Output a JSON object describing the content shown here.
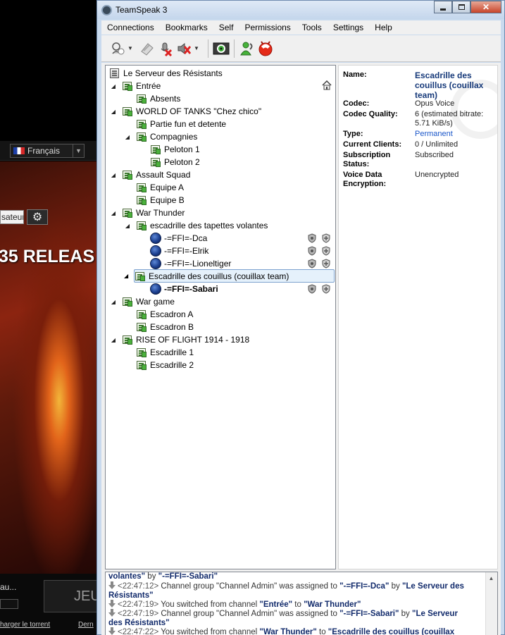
{
  "background_app": {
    "language": "Français",
    "user_button_label": "sateur",
    "banner_text": "35 RELEAS",
    "login_label": "au...",
    "play_button_label": "JEU",
    "download_link": "harger le torrent",
    "last_link": "Dern"
  },
  "window": {
    "title": "TeamSpeak 3"
  },
  "menu": [
    "Connections",
    "Bookmarks",
    "Self",
    "Permissions",
    "Tools",
    "Settings",
    "Help"
  ],
  "toolbar": {
    "icons": [
      "connect-icon",
      "disconnect-icon",
      "mute-microphone-icon",
      "mute-speakers-icon",
      "away-icon",
      "subscribe-icon",
      "identity-icon"
    ]
  },
  "tree": {
    "server": "Le Serveur des Résistants",
    "channels": [
      "Entrée",
      "Absents",
      "WORLD OF TANKS \"Chez chico\"",
      "Partie fun et detente",
      "Compagnies",
      "Peloton 1",
      "Peloton 2",
      "Assault Squad",
      "Equipe A",
      "Equipe B",
      "War Thunder",
      "escadrille des tapettes volantes",
      "Escadrille des couillus (couillax team)",
      "War game",
      "Escadron A",
      "Escadron B",
      "RISE OF FLIGHT 1914 - 1918",
      "Escadrille 1",
      "Escadrille 2"
    ],
    "clients": [
      "-=FFI=-Dca",
      "-=FFI=-Elrik",
      "-=FFI=-Lioneltiger",
      "-=FFI=-Sabari"
    ]
  },
  "info": {
    "name_label": "Name:",
    "name_value": "Escadrille des couillus (couillax team)",
    "codec_label": "Codec:",
    "codec_value": "Opus Voice",
    "quality_label": "Codec Quality:",
    "quality_value": "6 (estimated bitrate: 5.71 KiB/s)",
    "type_label": "Type:",
    "type_value": "Permanent",
    "clients_label": "Current Clients:",
    "clients_value": "0 / Unlimited",
    "subscription_label": "Subscription Status:",
    "subscription_value": "Subscribed",
    "encryption_label": "Voice Data Encryption:",
    "encryption_value": "Unencrypted"
  },
  "log": {
    "line1_name": "volantes\"",
    "line1_by": " by ",
    "line1_user": "\"-=FFI=-Sabari\"",
    "line2_time": "<22:47:12>",
    "line2_text": " Channel group \"Channel Admin\" was assigned to ",
    "line2_user": "\"-=FFI=-Dca\"",
    "line2_by": " by ",
    "line2_server": "\"Le Serveur des Résistants\"",
    "line3_time": "<22:47:19>",
    "line3_text": " You switched from channel ",
    "line3_from": "\"Entrée\"",
    "line3_to_word": " to ",
    "line3_to": "\"War Thunder\"",
    "line4_time": "<22:47:19>",
    "line4_text": " Channel group \"Channel Admin\" was assigned to ",
    "line4_user": "\"-=FFI=-Sabari\"",
    "line4_by": " by ",
    "line4_server": "\"Le Serveur des Résistants\"",
    "line5_time": "<22:47:22>",
    "line5_text": " You switched from channel ",
    "line5_from": "\"War Thunder\"",
    "line5_to_word": " to ",
    "line5_to": "\"Escadrille des couillus (couillax"
  }
}
